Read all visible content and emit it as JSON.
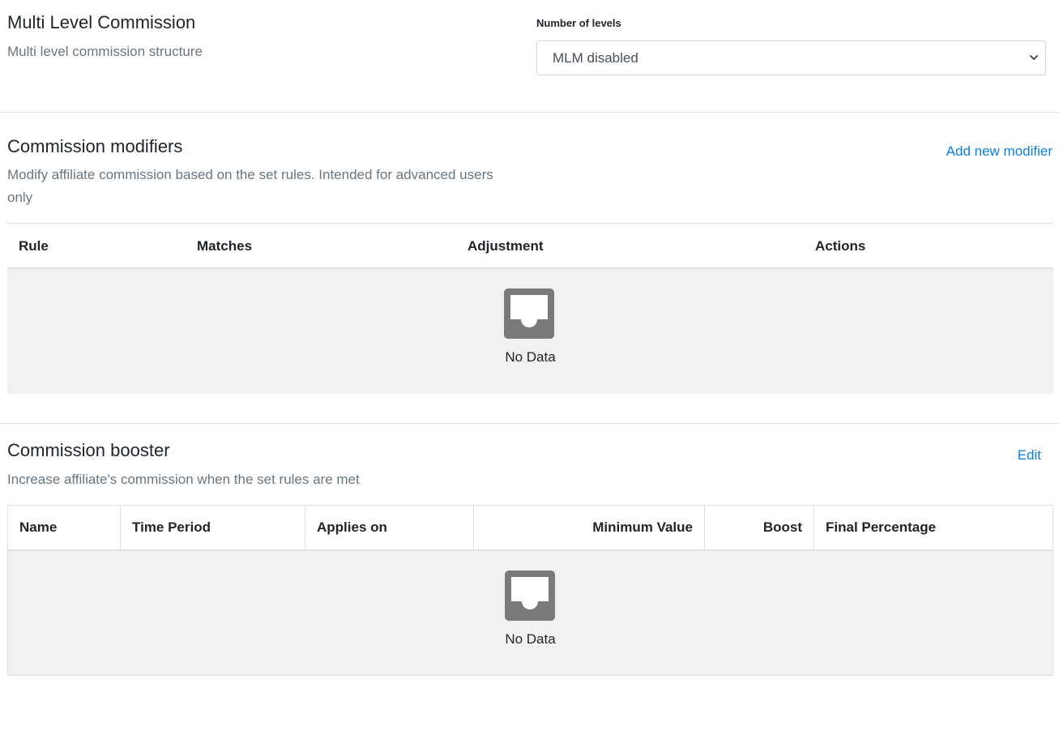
{
  "mlm": {
    "title": "Multi Level Commission",
    "description": "Multi level commission structure",
    "levels_label": "Number of levels",
    "levels_value": "MLM disabled"
  },
  "modifiers": {
    "title": "Commission modifiers",
    "description": "Modify affiliate commission based on the set rules. Intended for advanced users only",
    "add_label": "Add new modifier",
    "columns": [
      "Rule",
      "Matches",
      "Adjustment",
      "Actions"
    ],
    "empty_text": "No Data",
    "empty_icon": "inbox-icon"
  },
  "booster": {
    "title": "Commission booster",
    "description": "Increase affiliate's commission when the set rules are met",
    "edit_label": "Edit",
    "columns": [
      "Name",
      "Time Period",
      "Applies on",
      "Minimum Value",
      "Boost",
      "Final Percentage"
    ],
    "empty_text": "No Data",
    "empty_icon": "inbox-icon"
  },
  "colors": {
    "link": "#0d7ee3",
    "muted_text": "#6c757d",
    "empty_bg": "#f1f1f1",
    "icon_gray": "#7a7a7a"
  }
}
